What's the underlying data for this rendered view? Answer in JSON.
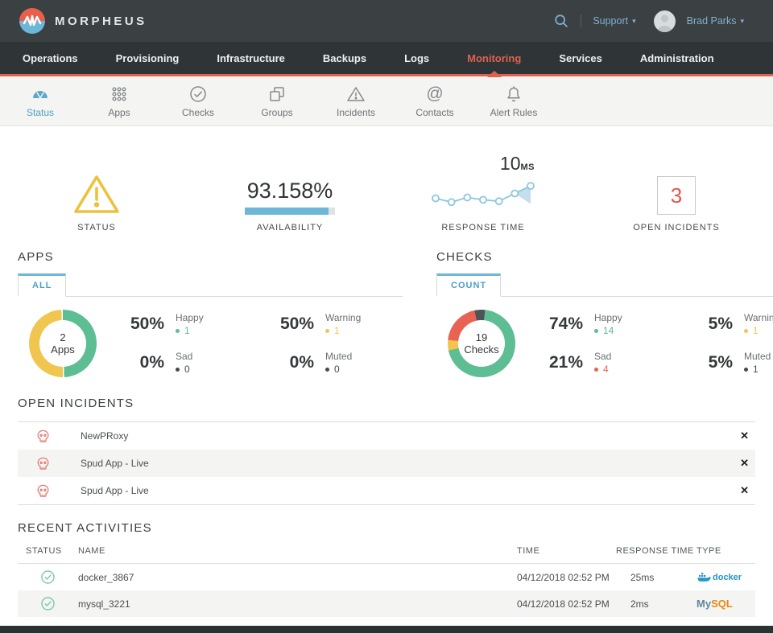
{
  "header": {
    "brand": "MORPHEUS",
    "support": "Support",
    "user": "Brad Parks",
    "caret": "▾"
  },
  "nav": {
    "items": [
      {
        "label": "Operations"
      },
      {
        "label": "Provisioning"
      },
      {
        "label": "Infrastructure"
      },
      {
        "label": "Backups"
      },
      {
        "label": "Logs"
      },
      {
        "label": "Monitoring"
      },
      {
        "label": "Services"
      },
      {
        "label": "Administration"
      }
    ],
    "active": "Monitoring"
  },
  "subnav": {
    "items": [
      {
        "label": "Status",
        "icon": "gauge-icon",
        "active": true
      },
      {
        "label": "Apps",
        "icon": "dot-grid-icon"
      },
      {
        "label": "Checks",
        "icon": "check-circle-icon"
      },
      {
        "label": "Groups",
        "icon": "stacked-squares-icon"
      },
      {
        "label": "Incidents",
        "icon": "warning-triangle-icon"
      },
      {
        "label": "Contacts",
        "icon": "at-sign-icon",
        "glyph": "@"
      },
      {
        "label": "Alert Rules",
        "icon": "bell-icon"
      }
    ]
  },
  "summary": {
    "status": {
      "label": "STATUS",
      "icon": "warning-triangle",
      "icon_color": "#ecc23c"
    },
    "availability": {
      "value": "93.158%",
      "label": "AVAILABILITY",
      "percent": 93.158,
      "bar_color": "#6cb6d8"
    },
    "response_time": {
      "value": "10",
      "unit": "MS",
      "label": "RESPONSE TIME",
      "points": [
        40,
        27,
        43,
        35,
        30,
        57,
        83
      ],
      "line_color": "#8ec6de",
      "fill_color": "#bcdcec"
    },
    "open_incidents": {
      "count": "3",
      "label": "OPEN INCIDENTS",
      "count_color": "#e0564c"
    }
  },
  "apps": {
    "title": "APPS",
    "tab": "ALL",
    "donut": {
      "center_value": "2",
      "center_label": "Apps",
      "segments": [
        {
          "name": "happy",
          "pct": 49.3,
          "color": "#5dbd93"
        },
        {
          "name": "gap",
          "pct": 0.7,
          "color": "#ffffff"
        },
        {
          "name": "warning",
          "pct": 49.3,
          "color": "#f0c650"
        },
        {
          "name": "gap",
          "pct": 0.7,
          "color": "#ffffff"
        }
      ]
    },
    "stats": [
      {
        "pct": "50%",
        "label": "Happy",
        "count": "1",
        "color": "#5dbd93"
      },
      {
        "pct": "50%",
        "label": "Warning",
        "count": "1",
        "color": "#f0c650"
      },
      {
        "pct": "0%",
        "label": "Sad",
        "count": "0",
        "color": "#44494c"
      },
      {
        "pct": "0%",
        "label": "Muted",
        "count": "0",
        "color": "#44494c"
      }
    ]
  },
  "checks": {
    "title": "CHECKS",
    "tab": "COUNT",
    "donut": {
      "center_value": "19",
      "center_label": "Checks",
      "segments": [
        {
          "name": "muted",
          "pct": 5,
          "color": "#4d5357"
        },
        {
          "name": "happy",
          "pct": 70,
          "color": "#5dbd93"
        },
        {
          "name": "warning",
          "pct": 5,
          "color": "#f0c650"
        },
        {
          "name": "sad",
          "pct": 20,
          "color": "#e96352"
        }
      ]
    },
    "stats": [
      {
        "pct": "74%",
        "label": "Happy",
        "count": "14",
        "color": "#5dbd93"
      },
      {
        "pct": "5%",
        "label": "Warning",
        "count": "1",
        "color": "#f0c650"
      },
      {
        "pct": "21%",
        "label": "Sad",
        "count": "4",
        "color": "#e96352"
      },
      {
        "pct": "5%",
        "label": "Muted",
        "count": "1",
        "color": "#44494c"
      }
    ]
  },
  "incidents": {
    "title": "OPEN INCIDENTS",
    "close_glyph": "✕",
    "rows": [
      {
        "name": "NewPRoxy"
      },
      {
        "name": "Spud App - Live"
      },
      {
        "name": "Spud App - Live"
      }
    ]
  },
  "activities": {
    "title": "RECENT ACTIVITIES",
    "columns": {
      "status": "STATUS",
      "name": "NAME",
      "time": "TIME",
      "response": "RESPONSE TIME",
      "type": "TYPE"
    },
    "rows": [
      {
        "name": "docker_3867",
        "time": "04/12/2018 02:52 PM",
        "response": "25ms",
        "type": "docker"
      },
      {
        "name": "mysql_3221",
        "time": "04/12/2018 02:52 PM",
        "response": "2ms",
        "type": "MySQL",
        "type_parts": [
          "My",
          "SQL"
        ]
      }
    ]
  }
}
